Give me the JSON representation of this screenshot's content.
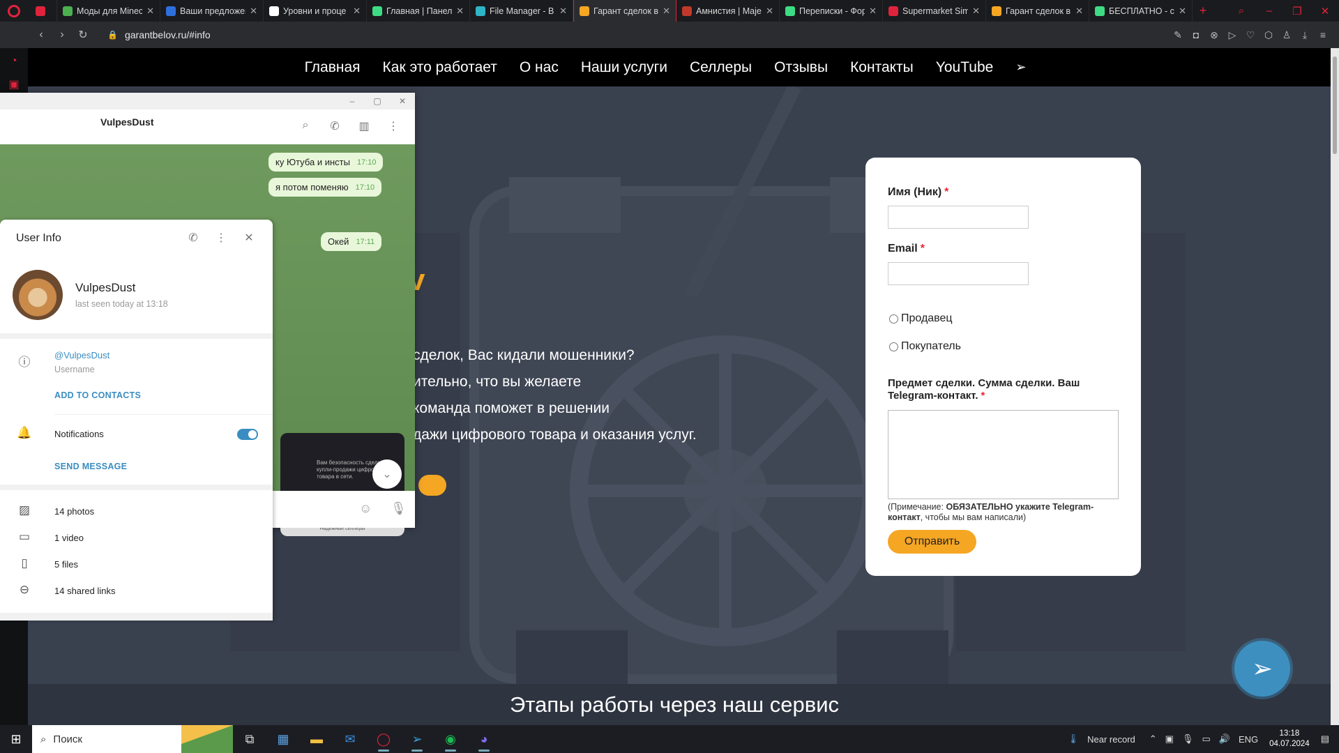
{
  "browser": {
    "tabs": [
      {
        "title": "",
        "color": "#e0233d"
      },
      {
        "title": "Моды для Minec",
        "color": "#4caf50"
      },
      {
        "title": "Ваши предложен",
        "color": "#2f6fdc"
      },
      {
        "title": "Уровни и проце",
        "color": "#ffffff"
      },
      {
        "title": "Главная | Панел",
        "color": "#3ddc84"
      },
      {
        "title": "File Manager - B",
        "color": "#2fb5c8"
      },
      {
        "title": "Гарант сделок в",
        "color": "#f5a623",
        "active": true
      },
      {
        "title": "Амнистия | Maje",
        "color": "#c0392b"
      },
      {
        "title": "Переписки - Фор",
        "color": "#3ddc84"
      },
      {
        "title": "Supermarket Sim",
        "color": "#e0233d"
      },
      {
        "title": "Гарант сделок в",
        "color": "#f5a623"
      },
      {
        "title": "БЕСПЛАТНО - са",
        "color": "#3ddc84"
      }
    ],
    "new_tab": "+",
    "url": "garantbelov.ru/#info"
  },
  "site": {
    "nav": [
      "Главная",
      "Как это работает",
      "О нас",
      "Наши услуги",
      "Селлеры",
      "Отзывы",
      "Контакты",
      "YouTube"
    ],
    "hero": {
      "title_fragment": "v",
      "lines": [
        "сделок, Вас кидали мошенники?",
        "ительно, что вы желаете",
        "команда поможет в решении",
        "дажи цифрового товара и оказания услуг."
      ]
    },
    "stages_title": "Этапы работы через наш сервис",
    "form": {
      "name_label": "Имя (Ник)",
      "email_label": "Email",
      "required_mark": "*",
      "radio_seller": "Продавец",
      "radio_buyer": "Покупатель",
      "subject_label": "Предмет сделки. Сумма сделки. Ваш Telegram-контакт.",
      "note_prefix": "(Примечание: ",
      "note_bold": "ОБЯЗАТЕЛЬНО укажите Telegram-контакт",
      "note_suffix": ", чтобы мы вам написали)",
      "submit": "Отправить"
    }
  },
  "telegram": {
    "chat_name": "VulpesDust",
    "messages": [
      {
        "text": "ку Ютуба и инсты",
        "time": "17:10"
      },
      {
        "text": "я потом поменяю",
        "time": "17:10"
      },
      {
        "text": "Окей",
        "time": "17:11"
      }
    ],
    "media_caption": "Вам безопасность сделки купли-продажи цифрового товара в сети.",
    "media_footer": "Надёжные селлеры",
    "user_info": {
      "title": "User Info",
      "name": "VulpesDust",
      "last_seen": "last seen today at 13:18",
      "username": "@VulpesDust",
      "username_label": "Username",
      "add_contacts": "ADD TO CONTACTS",
      "notifications": "Notifications",
      "notifications_on": true,
      "send_message": "SEND MESSAGE",
      "media": [
        {
          "icon": "photo-icon",
          "label": "14 photos"
        },
        {
          "icon": "video-icon",
          "label": "1 video"
        },
        {
          "icon": "file-icon",
          "label": "5 files"
        },
        {
          "icon": "link-icon",
          "label": "14 shared links"
        }
      ]
    }
  },
  "taskbar": {
    "search_placeholder": "Поиск",
    "recording": "Near record",
    "lang": "ENG",
    "time": "13:18",
    "date": "04.07.2024"
  }
}
